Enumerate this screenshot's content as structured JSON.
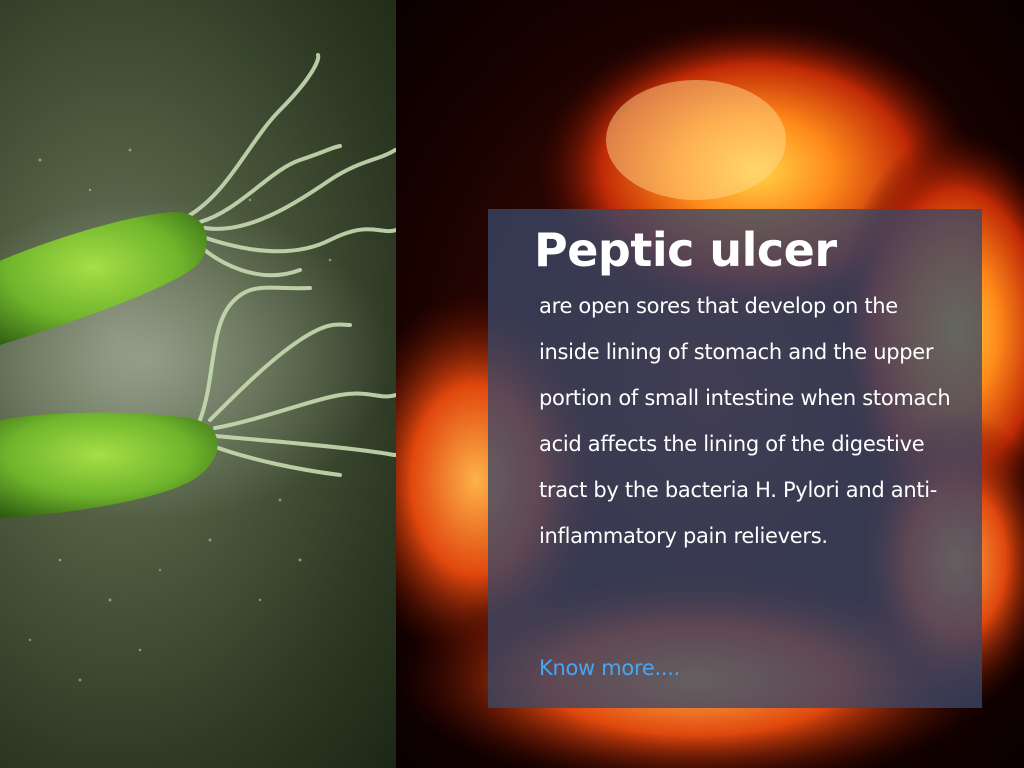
{
  "title": "Peptic ulcer",
  "description": "are open sores that develop on the inside lining of stomach and the upper portion of small intestine when stomach acid affects the lining of the digestive tract by the bacteria H. Pylori and anti-inflammatory pain relievers.",
  "link_label": "Know more....",
  "colors": {
    "card_background": "#3a4868",
    "title_text": "#ffffff",
    "body_text": "#ffffff",
    "link": "#46a6f2",
    "bacteria_green": "#6fb52c",
    "fire_orange": "#ff7a1a"
  }
}
